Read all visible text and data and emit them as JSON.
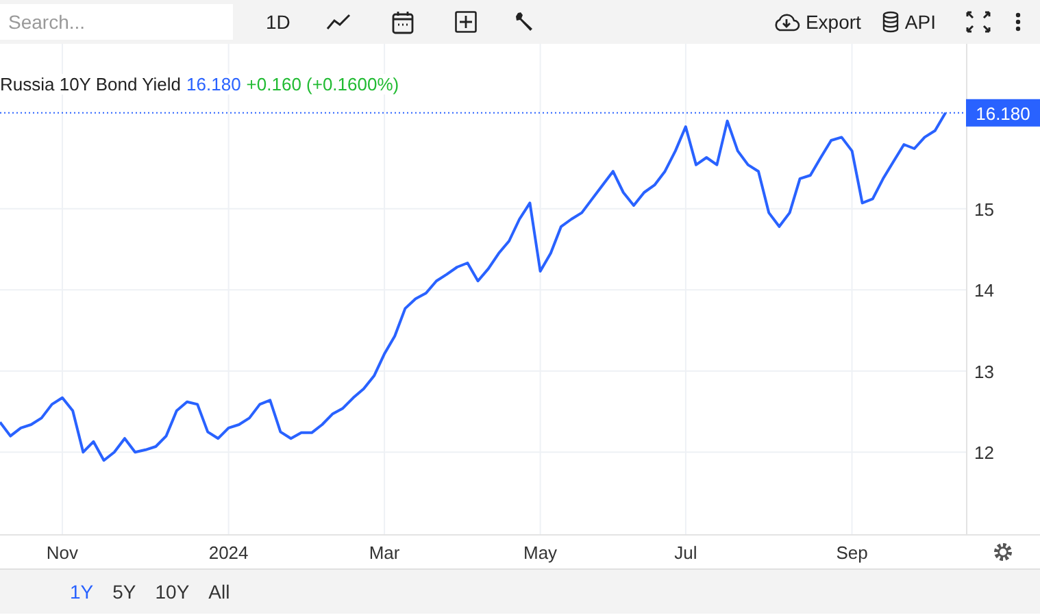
{
  "toolbar": {
    "search": {
      "placeholder": "Search..."
    },
    "interval": "1D",
    "export": "Export",
    "api": "API"
  },
  "quote": {
    "name": "Russia 10Y Bond Yield",
    "price": "16.180",
    "change": "+0.160 (+0.1600%)"
  },
  "chart_data": {
    "type": "line",
    "grid": true,
    "ref_lines": [
      {
        "axis": "y",
        "value": 16.18,
        "label": "16.180",
        "color": "#2962ff"
      }
    ],
    "ylim": [
      10.99,
      17.03
    ],
    "yticks": [
      12,
      13,
      14,
      15
    ],
    "categories": [
      null,
      null,
      null,
      null,
      null,
      null,
      "Nov",
      null,
      null,
      null,
      null,
      null,
      null,
      null,
      null,
      null,
      null,
      null,
      null,
      null,
      null,
      null,
      "2024",
      null,
      null,
      null,
      null,
      null,
      null,
      null,
      null,
      null,
      null,
      null,
      null,
      null,
      null,
      "Mar",
      null,
      null,
      null,
      null,
      null,
      null,
      null,
      null,
      null,
      null,
      null,
      null,
      null,
      null,
      "May",
      null,
      null,
      null,
      null,
      null,
      null,
      null,
      null,
      null,
      null,
      null,
      null,
      null,
      "Jul",
      null,
      null,
      null,
      null,
      null,
      null,
      null,
      null,
      null,
      null,
      null,
      null,
      null,
      null,
      null,
      "Sep",
      null,
      null,
      null,
      null,
      null,
      null,
      null,
      null,
      null
    ],
    "series": [
      {
        "color": "#2962ff",
        "values": [
          12.37,
          12.2,
          12.3,
          12.34,
          12.42,
          12.59,
          12.67,
          12.51,
          12.0,
          12.13,
          11.9,
          12.0,
          12.17,
          12.0,
          12.03,
          12.07,
          12.2,
          12.51,
          12.62,
          12.59,
          12.25,
          12.17,
          12.3,
          12.34,
          12.42,
          12.59,
          12.64,
          12.25,
          12.17,
          12.24,
          12.24,
          12.34,
          12.47,
          12.54,
          12.67,
          12.78,
          12.94,
          13.21,
          13.43,
          13.77,
          13.89,
          13.96,
          14.11,
          14.19,
          14.28,
          14.33,
          14.11,
          14.26,
          14.45,
          14.6,
          14.87,
          15.07,
          14.23,
          14.45,
          14.78,
          14.87,
          14.95,
          15.12,
          15.29,
          15.46,
          15.2,
          15.04,
          15.2,
          15.29,
          15.46,
          15.71,
          16.01,
          15.54,
          15.63,
          15.54,
          16.08,
          15.71,
          15.54,
          15.46,
          14.95,
          14.78,
          14.95,
          15.37,
          15.41,
          15.63,
          15.84,
          15.88,
          15.71,
          15.07,
          15.12,
          15.37,
          15.58,
          15.79,
          15.74,
          15.88,
          15.96,
          16.18
        ]
      }
    ]
  },
  "ranges": [
    {
      "label": "1Y",
      "selected": true
    },
    {
      "label": "5Y",
      "selected": false
    },
    {
      "label": "10Y",
      "selected": false
    },
    {
      "label": "All",
      "selected": false
    }
  ]
}
